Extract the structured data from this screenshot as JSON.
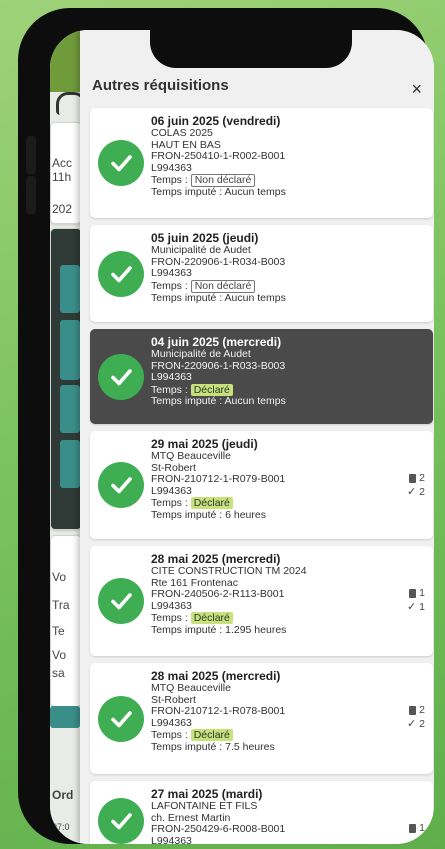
{
  "panel": {
    "title": "Autres réquisitions",
    "close_label": "×"
  },
  "background_app": {
    "snippets": [
      "Acc",
      "11h",
      "202",
      "Vo",
      "Tra",
      "Te",
      "Vo",
      "sa",
      "Ord",
      "07:0"
    ]
  },
  "temps_label": "Temps :",
  "requisitions": [
    {
      "date": "06 juin 2025 (vendredi)",
      "lines": [
        "COLAS 2025",
        "HAUT EN BAS",
        "FRON-250410-1-R002-B001",
        "L994363"
      ],
      "status": "Non déclaré",
      "declared": false,
      "imputed": "Temps imputé : Aucun temps",
      "active": false
    },
    {
      "date": "05 juin 2025 (jeudi)",
      "lines": [
        "Municipalité de Audet",
        "FRON-220906-1-R034-B003",
        "L994363"
      ],
      "status": "Non déclaré",
      "declared": false,
      "imputed": "Temps imputé : Aucun temps",
      "active": false
    },
    {
      "date": "04 juin 2025 (mercredi)",
      "lines": [
        "Municipalité de Audet",
        "FRON-220906-1-R033-B003",
        "L994363"
      ],
      "status": "Déclaré",
      "declared": true,
      "imputed": "Temps imputé : Aucun temps",
      "active": true
    },
    {
      "date": "29 mai 2025 (jeudi)",
      "lines": [
        "MTQ Beauceville",
        "St-Robert",
        "FRON-210712-1-R079-B001",
        "L994363"
      ],
      "status": "Déclaré",
      "declared": true,
      "imputed": "Temps imputé : 6 heures",
      "active": false,
      "doc_count": "2",
      "check_count": "2"
    },
    {
      "date": "28 mai 2025 (mercredi)",
      "lines": [
        "CITE CONSTRUCTION TM 2024",
        "Rte 161 Frontenac",
        "FRON-240506-2-R113-B001",
        "L994363"
      ],
      "status": "Déclaré",
      "declared": true,
      "imputed": "Temps imputé : 1.295 heures",
      "active": false,
      "doc_count": "1",
      "check_count": "1"
    },
    {
      "date": "28 mai 2025 (mercredi)",
      "lines": [
        "MTQ Beauceville",
        "St-Robert",
        "FRON-210712-1-R078-B001",
        "L994363"
      ],
      "status": "Déclaré",
      "declared": true,
      "imputed": "Temps imputé : 7.5 heures",
      "active": false,
      "doc_count": "2",
      "check_count": "2"
    },
    {
      "date": "27 mai 2025 (mardi)",
      "lines": [
        "LAFONTAINE ET FILS",
        "ch. Ernest Martin",
        "FRON-250429-6-R008-B001",
        "L994363"
      ],
      "status": "",
      "declared": true,
      "imputed": "",
      "active": false,
      "doc_count": "1"
    }
  ]
}
